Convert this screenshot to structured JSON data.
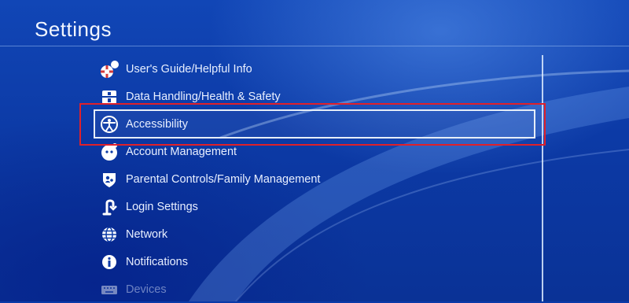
{
  "header": {
    "title": "Settings"
  },
  "menu": {
    "items": [
      {
        "label": "User's Guide/Helpful Info",
        "icon": "help-info-icon"
      },
      {
        "label": "Data Handling/Health & Safety",
        "icon": "first-aid-icon"
      },
      {
        "label": "Accessibility",
        "icon": "accessibility-icon",
        "selected": true
      },
      {
        "label": "Account Management",
        "icon": "account-icon"
      },
      {
        "label": "Parental Controls/Family Management",
        "icon": "parental-controls-icon"
      },
      {
        "label": "Login Settings",
        "icon": "login-icon"
      },
      {
        "label": "Network",
        "icon": "globe-icon"
      },
      {
        "label": "Notifications",
        "icon": "info-icon"
      },
      {
        "label": "Devices",
        "icon": "keyboard-icon"
      }
    ]
  },
  "colors": {
    "background": "#0a3aa8",
    "highlight_border": "#e0202a",
    "focus_border": "#e6eef8"
  }
}
